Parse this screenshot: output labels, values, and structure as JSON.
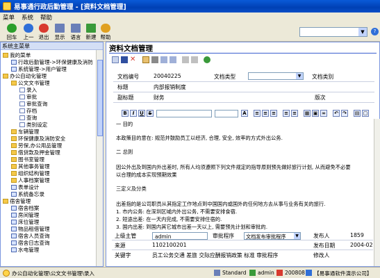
{
  "window": {
    "title": "易事通行政后勤管理 - [资料文档管理]"
  },
  "menu": [
    "菜单",
    "系统",
    "帮助"
  ],
  "toolbar": [
    {
      "label": "回车",
      "icon": "check-icon",
      "color": "#2b9e2b"
    },
    {
      "label": "上一",
      "icon": "back-icon",
      "color": "#2f6fd8"
    },
    {
      "label": "退出",
      "icon": "exit-icon",
      "color": "#d83a2f"
    },
    {
      "label": "显示",
      "icon": "display-icon",
      "color": "#6a7fb8"
    },
    {
      "label": "语言",
      "icon": "language-icon",
      "color": "#6a7fb8"
    },
    {
      "label": "新建",
      "icon": "new-icon",
      "color": "#3a9a3a"
    },
    {
      "label": "帮助",
      "icon": "help-icon",
      "color": "#e0a020"
    }
  ],
  "sidebar": {
    "header": "系统主菜单",
    "items": [
      {
        "label": "我的菜单",
        "icon": "folder-icon"
      },
      {
        "label": "行政后勤管理->环保健康及消防",
        "icon": "doc-icon"
      },
      {
        "label": "系统管理->用户管理",
        "icon": "doc-icon"
      },
      {
        "label": "办公自动化管理",
        "icon": "folder-icon"
      },
      {
        "label": "公文文书管理",
        "icon": "folder-icon"
      },
      {
        "label": "录入",
        "icon": "doc-icon"
      },
      {
        "label": "审批",
        "icon": "doc-icon"
      },
      {
        "label": "审批查询",
        "icon": "doc-icon"
      },
      {
        "label": "存档",
        "icon": "doc-icon"
      },
      {
        "label": "查询",
        "icon": "doc-icon"
      },
      {
        "label": "类别设定",
        "icon": "doc-icon"
      },
      {
        "label": "车辆管理",
        "icon": "folder-icon"
      },
      {
        "label": "环保健康及消防安全",
        "icon": "folder-icon"
      },
      {
        "label": "劳保,办公用品管理",
        "icon": "folder-icon"
      },
      {
        "label": "借贷款及押金管理",
        "icon": "folder-icon"
      },
      {
        "label": "图书室管理",
        "icon": "folder-icon"
      },
      {
        "label": "其他事务管理",
        "icon": "folder-icon"
      },
      {
        "label": "组织结构管理",
        "icon": "folder-icon"
      },
      {
        "label": "人事档案管理",
        "icon": "folder-icon"
      },
      {
        "label": "表单设计",
        "icon": "doc-icon"
      },
      {
        "label": "系统备忘录",
        "icon": "doc-icon"
      },
      {
        "label": "宿舍管理",
        "icon": "folder-icon"
      },
      {
        "label": "宿舍档案",
        "icon": "doc-icon"
      },
      {
        "label": "房间管理",
        "icon": "doc-icon"
      },
      {
        "label": "床位管理",
        "icon": "doc-icon"
      },
      {
        "label": "物品租借管理",
        "icon": "doc-icon"
      },
      {
        "label": "宿舍人员查询",
        "icon": "doc-icon"
      },
      {
        "label": "宿舍日志查询",
        "icon": "doc-icon"
      },
      {
        "label": "水电管理",
        "icon": "doc-icon"
      }
    ]
  },
  "main": {
    "title": "资料文档管理",
    "fields": {
      "doc_no_label": "文档编号",
      "doc_no": "20040225",
      "doc_type_label": "文档类型",
      "doc_type": "",
      "doc_category_label": "文档类别",
      "doc_category": "",
      "title_label": "标题",
      "title": "内部报销制度",
      "subtitle_label": "副标题",
      "subtitle": "财务",
      "version_label": "版次",
      "version": ""
    },
    "editor": [
      "一 目的",
      "本政策目的意在: 规范并鼓励员工以经济, 合理, 安全, 效率的方式外出公务.",
      "二 总则",
      "因公外出及到国内外出差时, 所有人均须遵照下列文件规定的指导原则预先做好旅行计划, 从而避免不必要",
      "以合理的成本实现预期效果",
      "三定义及分类",
      "出差指的是公司职员从其指定工作地点到中国国内或国外的任何地方去从事与业务有关的旅行.",
      "1.    市内公务:   在深圳区域内外出公务, 不需要安排食宿.",
      "2.    短途出差:   在一天内完成, 不需要安排住宿的.",
      "3.    国内出差:   到国内其它城市出差一天以上, 需要预先计划和审批的."
    ],
    "approval": {
      "supervisor_label": "上级主管",
      "supervisor": "admin",
      "process_label": "审批程序",
      "process": "文档发布审批程序",
      "publisher_label": "发布人",
      "publisher": "1859",
      "source_label": "来源",
      "source": "1102100201",
      "date_label": "发布日期",
      "date": "2004-02",
      "keyword_label": "关键字",
      "keyword": "员工公务交通 差旅 交际应酬报销政策 标准 审批程序",
      "modifier_label": "修改人",
      "modifier": ""
    }
  },
  "status": {
    "path": "办公自动化管理\\公文文书管理\\录入",
    "style": "Standard",
    "user": "admin",
    "user_id": "200808",
    "company": "【易事通软件演示公司】"
  }
}
